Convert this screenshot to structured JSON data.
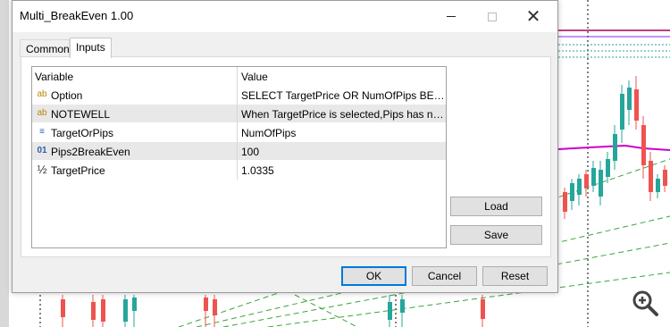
{
  "dialog": {
    "title": "Multi_BreakEven 1.00",
    "window_controls": {
      "minimize": "minimize-icon",
      "maximize": "maximize-icon",
      "close": "close-icon"
    }
  },
  "tabs": [
    {
      "label": "Common",
      "active": false
    },
    {
      "label": "Inputs",
      "active": true
    }
  ],
  "table": {
    "headers": {
      "variable": "Variable",
      "value": "Value"
    },
    "rows": [
      {
        "icon": "ab",
        "icon_name": "string-type-icon",
        "variable": "Option",
        "value": "SELECT TargetPrice OR NumOfPips BELOW"
      },
      {
        "icon": "ab",
        "icon_name": "string-type-icon",
        "variable": "NOTEWELL",
        "value": "When TargetPrice is selected,Pips has no e..."
      },
      {
        "icon": "≡",
        "icon_name": "enum-type-icon",
        "variable": "TargetOrPips",
        "value": "NumOfPips"
      },
      {
        "icon": "01",
        "icon_name": "integer-type-icon",
        "variable": "Pips2BreakEven",
        "value": "100"
      },
      {
        "icon": "½",
        "icon_name": "double-type-icon",
        "variable": "TargetPrice",
        "value": "1.0335"
      }
    ]
  },
  "buttons": {
    "load": "Load",
    "save": "Save",
    "ok": "OK",
    "cancel": "Cancel",
    "reset": "Reset"
  },
  "chart": {
    "zoom_icon": "zoom-in-icon"
  }
}
